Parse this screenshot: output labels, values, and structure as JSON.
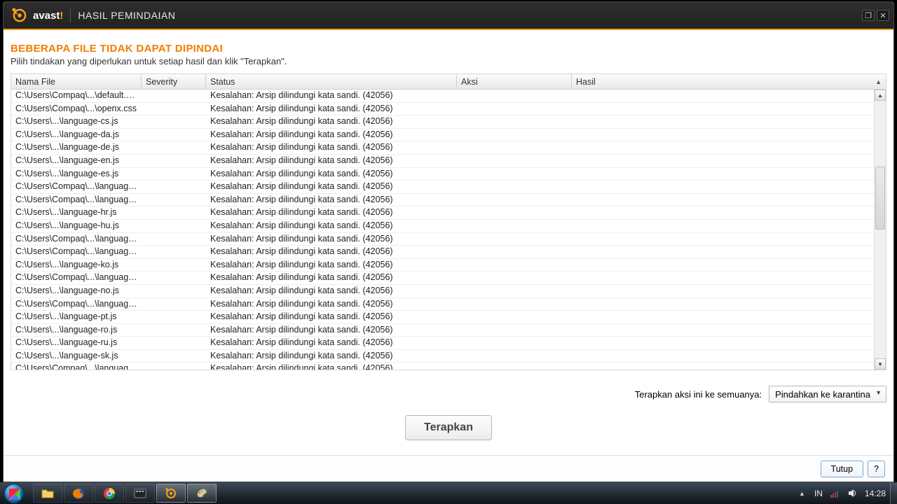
{
  "app": {
    "brand": "avast",
    "brand_exclaim": "!",
    "title": "HASIL PEMINDAIAN"
  },
  "window_controls": {
    "max_icon": "❐",
    "close_icon": "✕"
  },
  "heading": "BEBERAPA FILE TIDAK DAPAT DIPINDAI",
  "sub": "Pilih tindakan yang diperlukan untuk setiap hasil dan klik \"Terapkan\".",
  "columns": {
    "name": "Nama File",
    "severity": "Severity",
    "status": "Status",
    "aksi": "Aksi",
    "hasil": "Hasil"
  },
  "status_template": "Kesalahan: Arsip dilindungi kata sandi. (42056)",
  "rows": [
    {
      "name": "C:\\Users\\Compaq\\...\\default.css"
    },
    {
      "name": "C:\\Users\\Compaq\\...\\openx.css"
    },
    {
      "name": "C:\\Users\\...\\language-cs.js"
    },
    {
      "name": "C:\\Users\\...\\language-da.js"
    },
    {
      "name": "C:\\Users\\...\\language-de.js"
    },
    {
      "name": "C:\\Users\\...\\language-en.js"
    },
    {
      "name": "C:\\Users\\...\\language-es.js"
    },
    {
      "name": "C:\\Users\\Compaq\\...\\language-fi.js"
    },
    {
      "name": "C:\\Users\\Compaq\\...\\language-fr.js"
    },
    {
      "name": "C:\\Users\\...\\language-hr.js"
    },
    {
      "name": "C:\\Users\\...\\language-hu.js"
    },
    {
      "name": "C:\\Users\\Compaq\\...\\language-it.js"
    },
    {
      "name": "C:\\Users\\Compaq\\...\\language-ja.js"
    },
    {
      "name": "C:\\Users\\...\\language-ko.js"
    },
    {
      "name": "C:\\Users\\Compaq\\...\\language-nl.js"
    },
    {
      "name": "C:\\Users\\...\\language-no.js"
    },
    {
      "name": "C:\\Users\\Compaq\\...\\language-pl.js"
    },
    {
      "name": "C:\\Users\\...\\language-pt.js"
    },
    {
      "name": "C:\\Users\\...\\language-ro.js"
    },
    {
      "name": "C:\\Users\\...\\language-ru.js"
    },
    {
      "name": "C:\\Users\\...\\language-sk.js"
    },
    {
      "name": "C:\\Users\\Compaq\\...\\language-sl.js"
    }
  ],
  "apply_all_label": "Terapkan aksi ini ke semuanya:",
  "apply_all_selected": "Pindahkan ke karantina",
  "apply_button": "Terapkan",
  "footer": {
    "close": "Tutup",
    "help": "?"
  },
  "taskbar": {
    "lang": "IN",
    "time": "14:28"
  }
}
